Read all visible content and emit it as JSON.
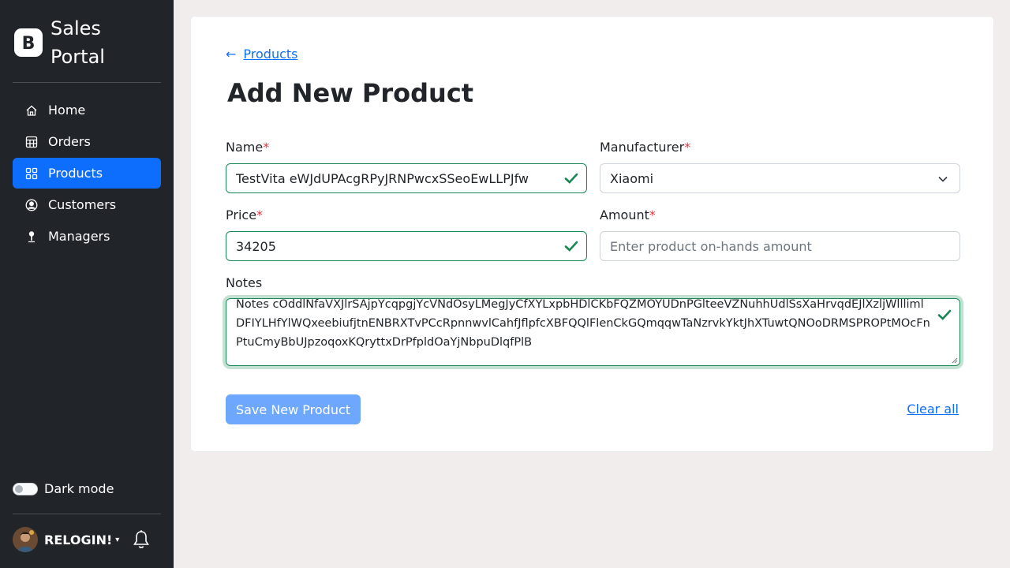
{
  "app": {
    "brand": "Sales Portal"
  },
  "sidebar": {
    "items": [
      {
        "label": "Home",
        "icon": "house-icon"
      },
      {
        "label": "Orders",
        "icon": "table-icon"
      },
      {
        "label": "Products",
        "icon": "grid-icon",
        "active": true
      },
      {
        "label": "Customers",
        "icon": "person-circle-icon"
      },
      {
        "label": "Managers",
        "icon": "person-pin-icon"
      }
    ],
    "dark_mode_label": "Dark mode",
    "user": {
      "name": "RELOGIN!"
    }
  },
  "page": {
    "back_link": "Products",
    "title": "Add New Product"
  },
  "form": {
    "name": {
      "label": "Name",
      "required": "*",
      "value": "TestVita eWJdUPAcgRPyJRNPwcxSSeoEwLLPJfw"
    },
    "manufacturer": {
      "label": "Manufacturer",
      "required": "*",
      "value": "Xiaomi"
    },
    "price": {
      "label": "Price",
      "required": "*",
      "value": "34205"
    },
    "amount": {
      "label": "Amount",
      "required": "*",
      "placeholder": "Enter product on-hands amount"
    },
    "notes": {
      "label": "Notes",
      "value": "Notes cOddlNfaVXJlrSAjpYcqpgjYcVNdOsyLMegJyCfXYLxpbHDlCKbFQZMOYUDnPGlteeVZNuhhUdlSsXaHrvqdEJlXzljWlllimlDFIYLHfYlWQxeebiufjtnENBRXTvPCcRpnnwvlCahfJflpfcXBFQQlFlenCkGQmqqwTaNzrvkYktJhXTuwtQNOoDRMSPROPtMOcFnPtuCmyBbUJpzoqoxKQryttxDrPfpldOaYjNbpuDlqfPlB"
    },
    "save_button": "Save New Product",
    "clear_link": "Clear all"
  },
  "colors": {
    "primary": "#0d6efd",
    "success": "#198754",
    "sidebar": "#212529",
    "danger": "#dc3545"
  }
}
